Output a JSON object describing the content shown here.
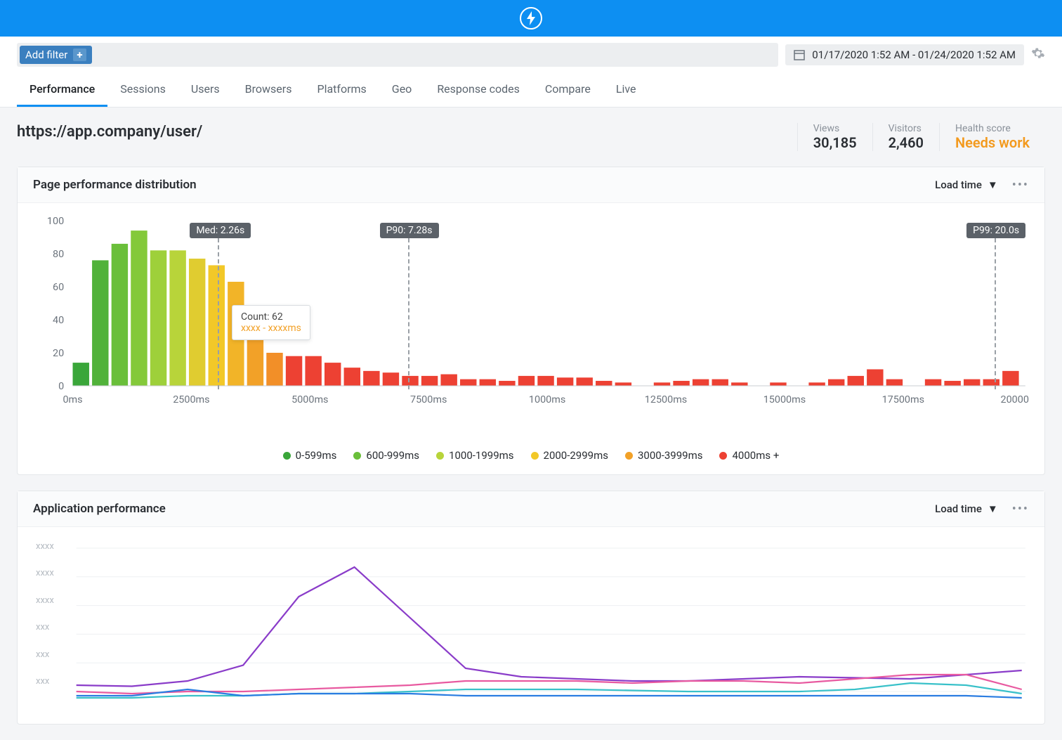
{
  "filter": {
    "add_label": "Add filter"
  },
  "daterange": "01/17/2020 1:52 AM - 01/24/2020 1:52 AM",
  "tabs": [
    "Performance",
    "Sessions",
    "Users",
    "Browsers",
    "Platforms",
    "Geo",
    "Response codes",
    "Compare",
    "Live"
  ],
  "active_tab": 0,
  "page_url": "https://app.company/user/",
  "stats": {
    "views": {
      "label": "Views",
      "value": "30,185"
    },
    "visitors": {
      "label": "Visitors",
      "value": "2,460"
    },
    "health": {
      "label": "Health score",
      "value": "Needs work"
    }
  },
  "dist_card": {
    "title": "Page performance distribution",
    "selector": "Load time",
    "markers": {
      "med": "Med: 2.26s",
      "p90": "P90: 7.28s",
      "p99": "P99: 20.0s"
    },
    "tooltip": {
      "line1": "Count: 62",
      "line2": "xxxx - xxxxms"
    },
    "yticks": [
      0,
      20,
      40,
      60,
      80,
      100
    ],
    "xticks": [
      "0ms",
      "2500ms",
      "5000ms",
      "7500ms",
      "1000ms",
      "12500ms",
      "15000ms",
      "17500ms",
      "20000ms"
    ],
    "legend": [
      {
        "label": "0-599ms",
        "color": "#3aa63a"
      },
      {
        "label": "600-999ms",
        "color": "#6abf3a"
      },
      {
        "label": "1000-1999ms",
        "color": "#b8d43a"
      },
      {
        "label": "2000-2999ms",
        "color": "#f2c828"
      },
      {
        "label": "3000-3999ms",
        "color": "#f2a128"
      },
      {
        "label": "4000ms +",
        "color": "#ed4133"
      }
    ]
  },
  "app_card": {
    "title": "Application performance",
    "selector": "Load time",
    "yticks": [
      "xxxx",
      "xxxx",
      "xxxx",
      "xxx",
      "xxx",
      "xxx"
    ]
  },
  "chart_data": [
    {
      "type": "bar",
      "title": "Page performance distribution",
      "ylabel": "",
      "ylim": [
        0,
        100
      ],
      "bars": [
        {
          "v": 14,
          "c": "#3aa63a"
        },
        {
          "v": 76,
          "c": "#51b23a"
        },
        {
          "v": 86,
          "c": "#6abf3a"
        },
        {
          "v": 94,
          "c": "#84c93a"
        },
        {
          "v": 82,
          "c": "#9ed03a"
        },
        {
          "v": 82,
          "c": "#b8d43a"
        },
        {
          "v": 77,
          "c": "#e0cc30"
        },
        {
          "v": 73,
          "c": "#f2c828"
        },
        {
          "v": 63,
          "c": "#f2b428"
        },
        {
          "v": 30,
          "c": "#f2a128"
        },
        {
          "v": 20,
          "c": "#f28f28"
        },
        {
          "v": 18,
          "c": "#ed4133"
        },
        {
          "v": 18,
          "c": "#ed4133"
        },
        {
          "v": 14,
          "c": "#ed4133"
        },
        {
          "v": 11,
          "c": "#ed4133"
        },
        {
          "v": 9,
          "c": "#ed4133"
        },
        {
          "v": 8,
          "c": "#ed4133"
        },
        {
          "v": 6,
          "c": "#ed4133"
        },
        {
          "v": 6,
          "c": "#ed4133"
        },
        {
          "v": 7,
          "c": "#ed4133"
        },
        {
          "v": 4,
          "c": "#ed4133"
        },
        {
          "v": 4,
          "c": "#ed4133"
        },
        {
          "v": 3,
          "c": "#ed4133"
        },
        {
          "v": 6,
          "c": "#ed4133"
        },
        {
          "v": 6,
          "c": "#ed4133"
        },
        {
          "v": 5,
          "c": "#ed4133"
        },
        {
          "v": 5,
          "c": "#ed4133"
        },
        {
          "v": 3,
          "c": "#ed4133"
        },
        {
          "v": 2,
          "c": "#ed4133"
        },
        {
          "v": 0,
          "c": "#ed4133"
        },
        {
          "v": 2,
          "c": "#ed4133"
        },
        {
          "v": 3,
          "c": "#ed4133"
        },
        {
          "v": 4,
          "c": "#ed4133"
        },
        {
          "v": 4,
          "c": "#ed4133"
        },
        {
          "v": 2,
          "c": "#ed4133"
        },
        {
          "v": 0,
          "c": "#ed4133"
        },
        {
          "v": 2,
          "c": "#ed4133"
        },
        {
          "v": 0,
          "c": "#ed4133"
        },
        {
          "v": 2,
          "c": "#ed4133"
        },
        {
          "v": 4,
          "c": "#ed4133"
        },
        {
          "v": 6,
          "c": "#ed4133"
        },
        {
          "v": 10,
          "c": "#ed4133"
        },
        {
          "v": 4,
          "c": "#ed4133"
        },
        {
          "v": 0,
          "c": "#ed4133"
        },
        {
          "v": 4,
          "c": "#ed4133"
        },
        {
          "v": 3,
          "c": "#ed4133"
        },
        {
          "v": 4,
          "c": "#ed4133"
        },
        {
          "v": 4,
          "c": "#ed4133"
        },
        {
          "v": 9,
          "c": "#ed4133"
        }
      ],
      "marker_positions": {
        "med": 7.5,
        "p90": 17.3,
        "p99": 47.6
      }
    },
    {
      "type": "line",
      "title": "Application performance",
      "x": [
        0,
        1,
        2,
        3,
        4,
        5,
        6,
        7,
        8,
        9,
        10,
        11,
        12,
        13,
        14,
        15,
        16,
        17
      ],
      "series": [
        {
          "name": "purple",
          "color": "#8a3cc9",
          "values": [
            26,
            25,
            30,
            45,
            110,
            138,
            90,
            42,
            34,
            32,
            30,
            30,
            32,
            34,
            33,
            32,
            36,
            40
          ]
        },
        {
          "name": "pink",
          "color": "#e85aa0",
          "values": [
            20,
            18,
            20,
            20,
            22,
            24,
            26,
            30,
            30,
            30,
            28,
            30,
            30,
            28,
            32,
            36,
            36,
            22
          ]
        },
        {
          "name": "teal",
          "color": "#39c1c9",
          "values": [
            14,
            14,
            16,
            16,
            18,
            18,
            20,
            22,
            22,
            22,
            21,
            20,
            20,
            20,
            22,
            28,
            26,
            18
          ]
        },
        {
          "name": "blue",
          "color": "#2a7de1",
          "values": [
            16,
            16,
            22,
            16,
            18,
            18,
            18,
            16,
            16,
            16,
            16,
            16,
            16,
            16,
            16,
            16,
            16,
            14
          ]
        }
      ],
      "ylim": [
        0,
        160
      ]
    }
  ]
}
